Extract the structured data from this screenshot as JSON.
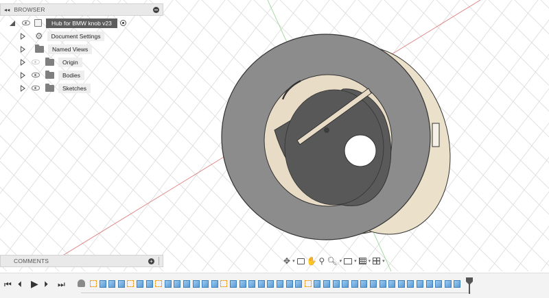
{
  "browser": {
    "title": "BROWSER",
    "root": {
      "label": "Hub for BMW knob v23"
    },
    "items": [
      {
        "label": "Document Settings",
        "icon": "gear-icon",
        "eye": false
      },
      {
        "label": "Named Views",
        "icon": "folder-icon",
        "eye": false
      },
      {
        "label": "Origin",
        "icon": "folder-icon",
        "eye": true,
        "eye_dim": true
      },
      {
        "label": "Bodies",
        "icon": "folder-icon",
        "eye": true,
        "eye_dim": false
      },
      {
        "label": "Sketches",
        "icon": "folder-icon",
        "eye": true,
        "eye_dim": false
      }
    ]
  },
  "comments": {
    "title": "COMMENTS"
  },
  "navbar": {
    "icons": [
      "orbit-icon",
      "look-at-icon",
      "pan-icon",
      "zoom-window-icon",
      "fit-icon",
      "display-settings-icon",
      "grid-icon",
      "viewports-icon"
    ]
  },
  "timeline": {
    "controls": [
      "skip-start-icon",
      "step-back-icon",
      "play-icon",
      "step-forward-icon",
      "skip-end-icon"
    ],
    "features": [
      "sketch",
      "body",
      "body",
      "body",
      "sketch",
      "body",
      "body",
      "sketch",
      "body",
      "body",
      "body",
      "body",
      "body",
      "body",
      "sketch",
      "body",
      "body",
      "body",
      "body",
      "body",
      "body",
      "body",
      "body",
      "sketch",
      "body",
      "body",
      "body",
      "body",
      "body",
      "body",
      "body",
      "body",
      "body",
      "body",
      "body",
      "body",
      "body",
      "body",
      "body",
      "body"
    ]
  },
  "colors": {
    "part_face": "#8c8c8c",
    "part_inner": "#555555",
    "part_wood": "#e8dcc6",
    "timeline_body": "#5a9bd6",
    "timeline_sketch": "#f0a020"
  }
}
